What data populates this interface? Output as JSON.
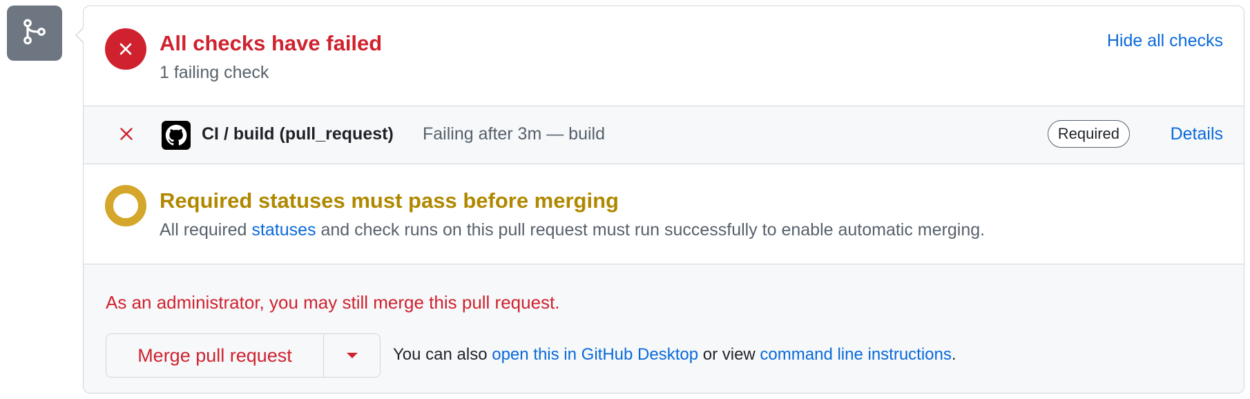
{
  "colors": {
    "danger": "#cf222e",
    "attention": "#d4a72c",
    "link": "#0969da",
    "muted": "#57606a",
    "icon_box": "#6e7681"
  },
  "icons": {
    "merge": "git-merge-icon",
    "fail": "x-circle-icon",
    "check_fail": "x-icon",
    "app": "github-logo-icon",
    "pending": "pending-ring-icon",
    "dropdown": "triangle-down-icon"
  },
  "checks_summary": {
    "title": "All checks have failed",
    "subtitle": "1 failing check",
    "toggle_label": "Hide all checks"
  },
  "checks": [
    {
      "name": "CI / build (pull_request)",
      "description": "Failing after 3m — build",
      "badge": "Required",
      "link_label": "Details"
    }
  ],
  "required_statuses": {
    "title": "Required statuses must pass before merging",
    "text_before": "All required ",
    "link": "statuses",
    "text_after": " and check runs on this pull request must run successfully to enable automatic merging."
  },
  "merge": {
    "admin_note": "As an administrator, you may still merge this pull request.",
    "button_label": "Merge pull request",
    "hint_before": "You can also ",
    "hint_link1": "open this in GitHub Desktop",
    "hint_middle": " or view ",
    "hint_link2": "command line instructions",
    "hint_after": "."
  }
}
